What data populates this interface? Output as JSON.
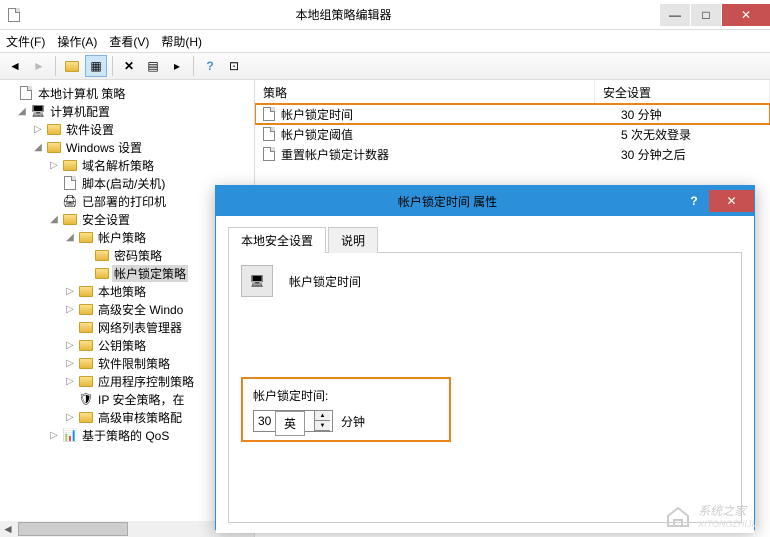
{
  "window": {
    "title": "本地组策略编辑器"
  },
  "menubar": {
    "file": "文件(F)",
    "action": "操作(A)",
    "view": "查看(V)",
    "help": "帮助(H)"
  },
  "tree": {
    "root": "本地计算机 策略",
    "computer_config": "计算机配置",
    "software_settings": "软件设置",
    "windows_settings": "Windows 设置",
    "name_resolution": "域名解析策略",
    "scripts": "脚本(启动/关机)",
    "deployed_printers": "已部署的打印机",
    "security_settings": "安全设置",
    "account_policies": "帐户策略",
    "password_policy": "密码策略",
    "account_lockout_policy": "帐户锁定策略",
    "local_policies": "本地策略",
    "advanced_windows": "高级安全 Windo",
    "network_list": "网络列表管理器",
    "public_key": "公钥策略",
    "software_restriction": "软件限制策略",
    "app_control": "应用程序控制策略",
    "ip_security": "IP 安全策略，在",
    "advanced_audit": "高级审核策略配",
    "qos": "基于策略的 QoS"
  },
  "list": {
    "header_policy": "策略",
    "header_setting": "安全设置",
    "rows": [
      {
        "policy": "帐户锁定时间",
        "setting": "30 分钟"
      },
      {
        "policy": "帐户锁定阈值",
        "setting": "5 次无效登录"
      },
      {
        "policy": "重置帐户锁定计数器",
        "setting": "30 分钟之后"
      }
    ]
  },
  "dialog": {
    "title": "帐户锁定时间 属性",
    "tab_local": "本地安全设置",
    "tab_explain": "说明",
    "policy_name": "帐户锁定时间",
    "field_label": "帐户锁定时间:",
    "value": "30",
    "unit": "分钟",
    "ime": "英"
  },
  "watermark": {
    "text": "系统之家",
    "sub": "XITONGZHIJIA"
  }
}
